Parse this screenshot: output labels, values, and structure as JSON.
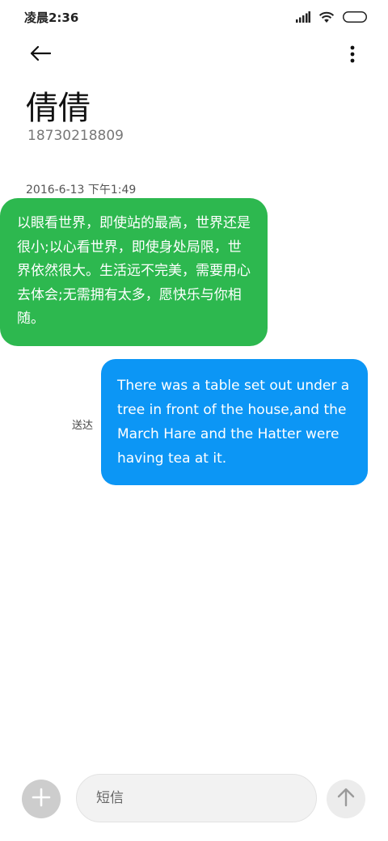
{
  "status_bar": {
    "time": "凌晨2:36",
    "icons": [
      "signal-icon",
      "wifi-icon",
      "battery-icon"
    ]
  },
  "header": {
    "back_icon": "arrow-left-icon",
    "more_icon": "more-vertical-icon"
  },
  "contact": {
    "name": "倩倩",
    "number": "18730218809"
  },
  "conversation": {
    "timestamp": "2016-6-13 下午1:49",
    "received_message": "以眼看世界，即使站的最高，世界还是很小;以心看世界，即使身处局限，世界依然很大。生活远不完美，需要用心去体会;无需拥有太多，愿快乐与你相随。",
    "sent_message": "There was a table set out under a tree in front of the house,and the March Hare and the Hatter were having tea at it.",
    "sent_status": "送达"
  },
  "composer": {
    "placeholder": "短信",
    "add_icon": "plus-icon",
    "send_icon": "arrow-up-icon"
  },
  "colors": {
    "received_bubble": "#2db84f",
    "sent_bubble": "#0c96f5"
  }
}
